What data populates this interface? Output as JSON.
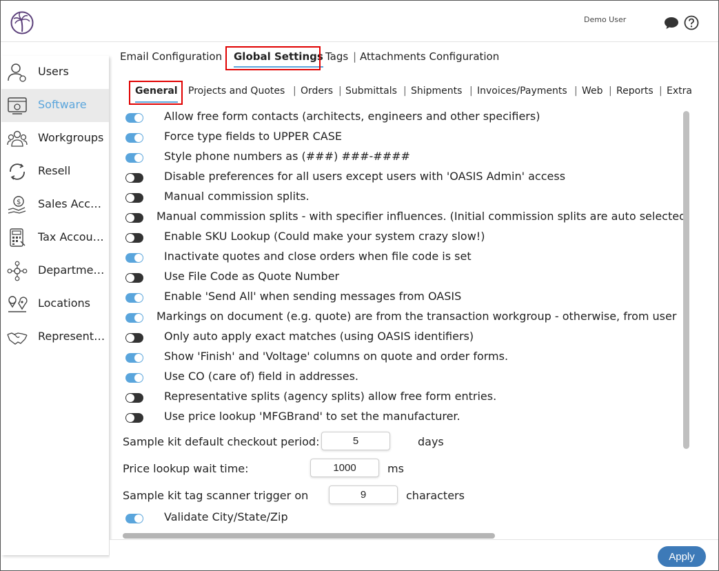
{
  "header": {
    "user_name": "Demo User",
    "logo_icon": "palm-tree-logo-icon",
    "chat_icon": "chat-bubble-icon",
    "help_icon": "help-circle-icon"
  },
  "sidebar": {
    "items": [
      {
        "label": "Users",
        "icon": "user-icon",
        "active": false
      },
      {
        "label": "Software",
        "icon": "software-icon",
        "active": true
      },
      {
        "label": "Workgroups",
        "icon": "workgroups-icon",
        "active": false
      },
      {
        "label": "Resell",
        "icon": "resell-icon",
        "active": false
      },
      {
        "label": "Sales Accounts",
        "icon": "sales-accounts-icon",
        "active": false
      },
      {
        "label": "Tax Accounts",
        "icon": "tax-accounts-icon",
        "active": false
      },
      {
        "label": "Departments",
        "icon": "departments-icon",
        "active": false
      },
      {
        "label": "Locations",
        "icon": "location-icon",
        "active": false
      },
      {
        "label": "Representatives",
        "icon": "handshake-icon",
        "active": false
      }
    ]
  },
  "tabs": [
    {
      "label": "Email Configuration",
      "active": false
    },
    {
      "label": "Global Settings",
      "active": true
    },
    {
      "label": "Tags",
      "active": false
    },
    {
      "label": "Attachments Configuration",
      "active": false
    }
  ],
  "subtabs": [
    {
      "label": "General",
      "active": true
    },
    {
      "label": "Projects and Quotes",
      "active": false
    },
    {
      "label": "Orders",
      "active": false
    },
    {
      "label": "Submittals",
      "active": false
    },
    {
      "label": "Shipments",
      "active": false
    },
    {
      "label": "Invoices/Payments",
      "active": false
    },
    {
      "label": "Web",
      "active": false
    },
    {
      "label": "Reports",
      "active": false
    },
    {
      "label": "Extra",
      "active": false
    }
  ],
  "settings": [
    {
      "label": "Allow free form contacts (architects, engineers and other specifiers)",
      "on": true
    },
    {
      "label": "Force type fields to UPPER CASE",
      "on": true
    },
    {
      "label": "Style phone numbers as (###) ###-####",
      "on": true
    },
    {
      "label": "Disable preferences for all users except users with 'OASIS Admin' access",
      "on": false
    },
    {
      "label": "Manual commission splits.",
      "on": false
    },
    {
      "label": "Manual commission splits - with specifier influences. (Initial commission splits are auto selected",
      "on": false
    },
    {
      "label": "Enable SKU Lookup (Could make your system crazy slow!)",
      "on": false
    },
    {
      "label": "Inactivate quotes and close orders when file code is set",
      "on": true
    },
    {
      "label": "Use File Code as Quote Number",
      "on": false
    },
    {
      "label": "Enable 'Send All' when sending messages from OASIS",
      "on": true
    },
    {
      "label": "Markings on document (e.g. quote) are from the transaction workgroup - otherwise, from user",
      "on": true
    },
    {
      "label": "Only auto apply exact matches (using OASIS identifiers)",
      "on": false
    },
    {
      "label": "Show 'Finish' and 'Voltage' columns on quote and order forms.",
      "on": true
    },
    {
      "label": "Use CO (care of) field in addresses.",
      "on": true
    },
    {
      "label": "Representative splits (agency splits) allow free form entries.",
      "on": false
    },
    {
      "label": "Use price lookup 'MFGBrand' to set the manufacturer.",
      "on": false
    }
  ],
  "fields": {
    "checkout": {
      "label": "Sample kit default checkout period:",
      "value": "5",
      "unit": "days"
    },
    "wait": {
      "label": "Price lookup wait time:",
      "value": "1000",
      "unit": "ms"
    },
    "scanner": {
      "label": "Sample kit tag scanner trigger on",
      "value": "9",
      "unit": "characters"
    }
  },
  "validate": {
    "label": "Validate City/State/Zip",
    "on": true
  },
  "footer": {
    "apply_label": "Apply"
  },
  "colors": {
    "accent": "#5aa5dc",
    "apply_button": "#3d7ab8",
    "highlight_box": "#e00000"
  }
}
